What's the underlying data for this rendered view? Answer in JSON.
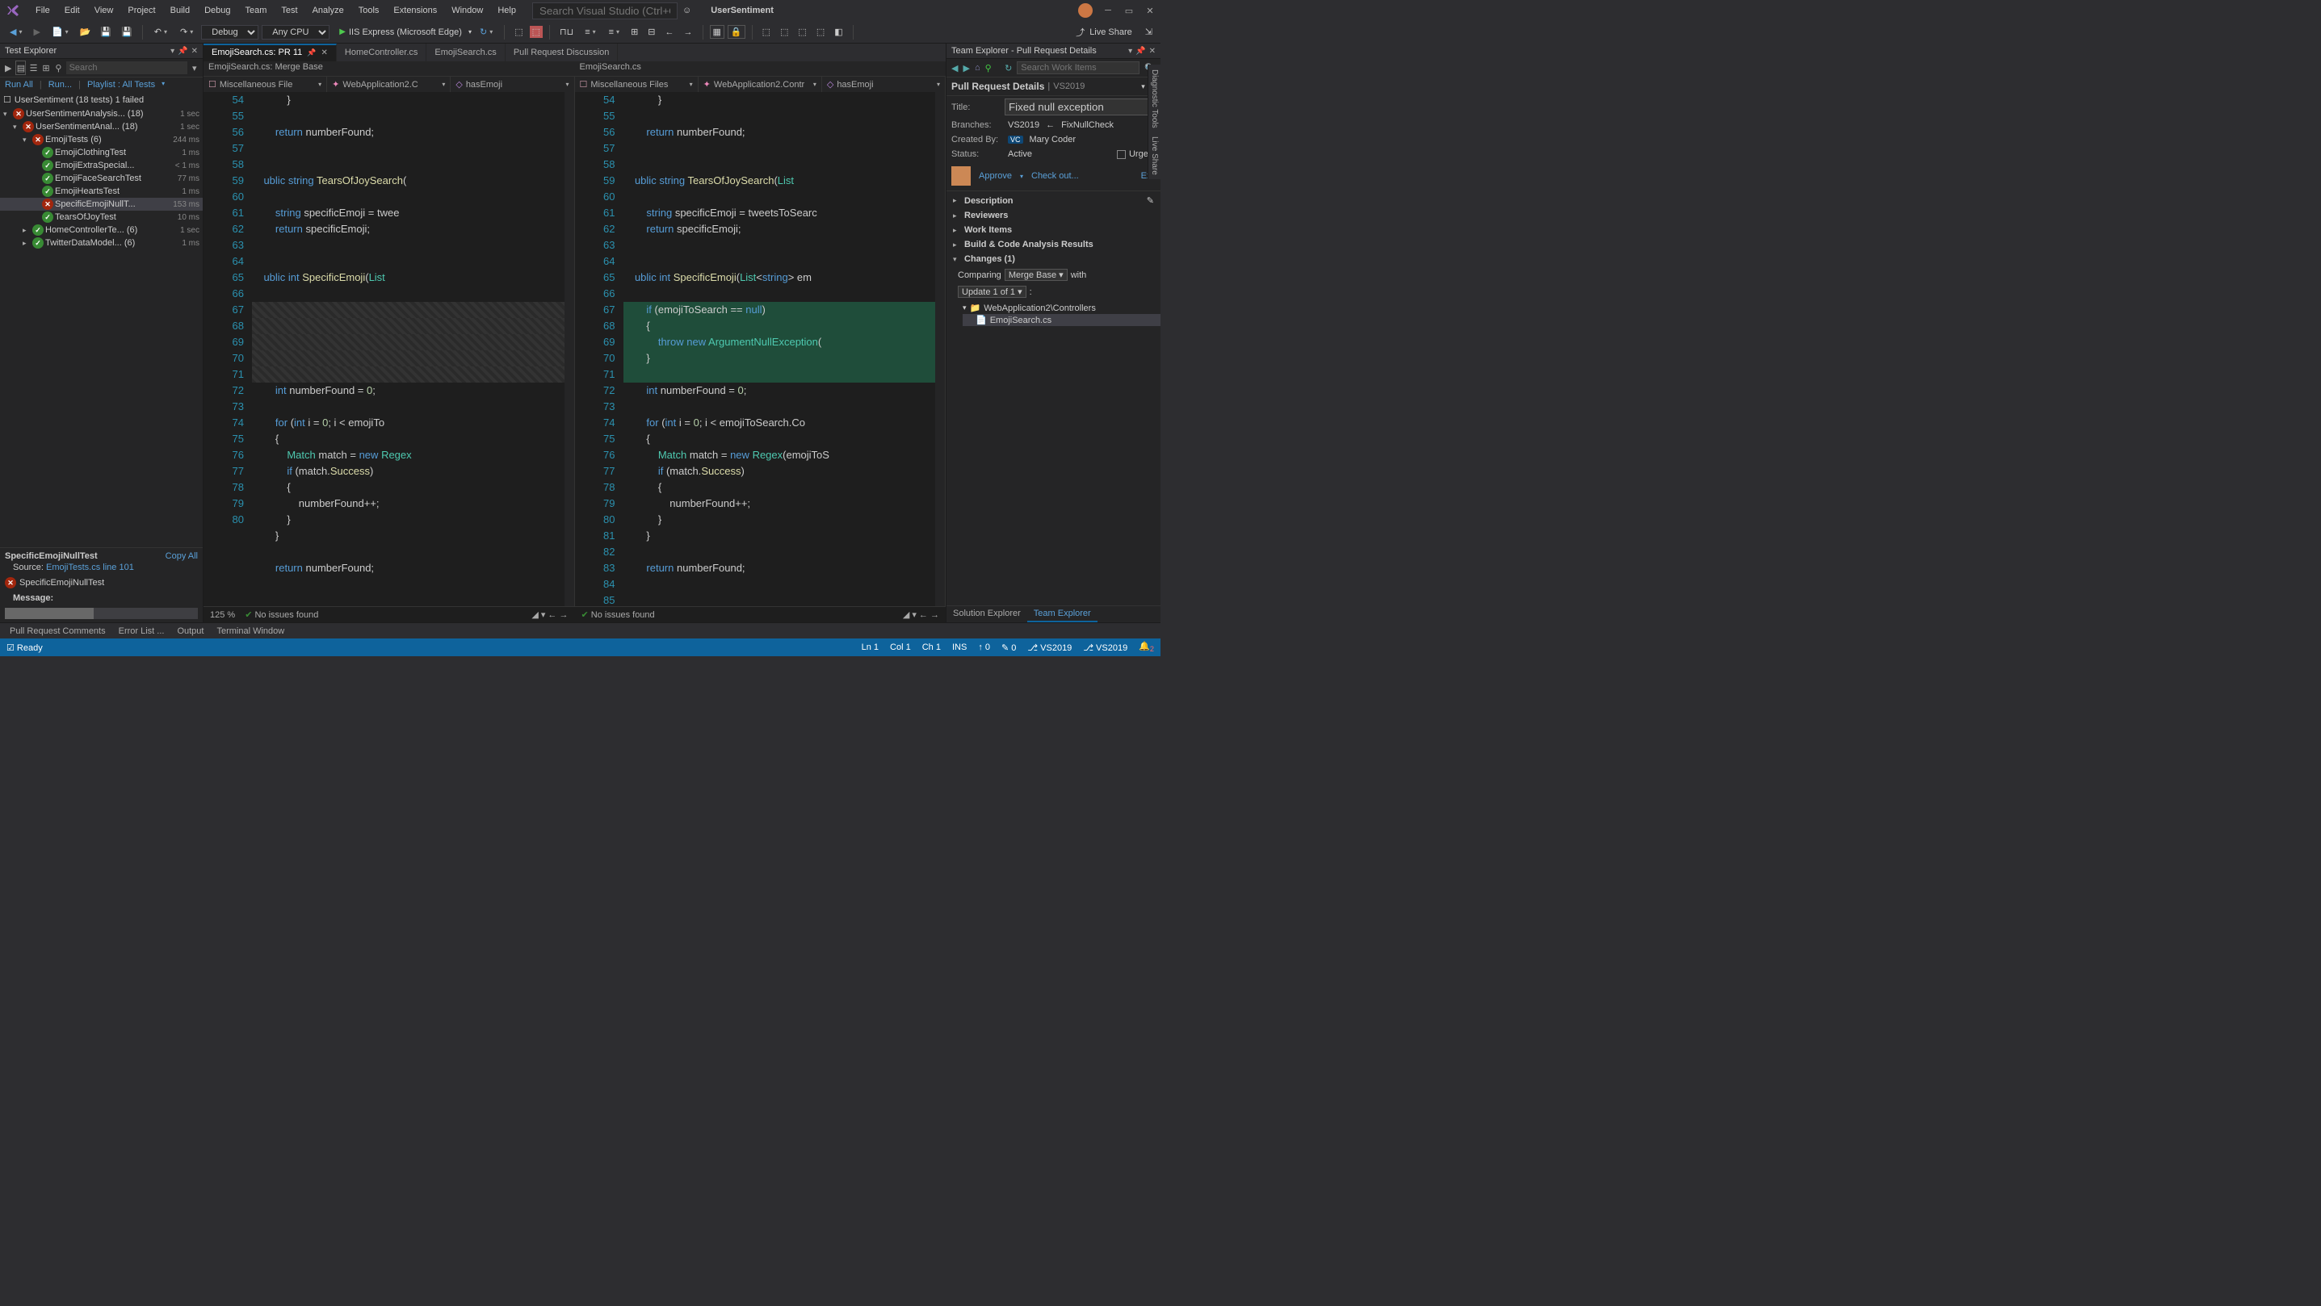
{
  "menu": [
    "File",
    "Edit",
    "View",
    "Project",
    "Build",
    "Debug",
    "Team",
    "Test",
    "Analyze",
    "Tools",
    "Extensions",
    "Window",
    "Help"
  ],
  "menuSearch": "Search Visual Studio (Ctrl+Q)",
  "solutionName": "UserSentiment",
  "toolbar": {
    "config": "Debug",
    "platform": "Any CPU",
    "run": "IIS Express (Microsoft Edge)",
    "liveshare": "Live Share"
  },
  "testExplorer": {
    "title": "Test Explorer",
    "searchPlaceholder": "Search",
    "links": [
      "Run All",
      "Run...",
      "Playlist : All Tests"
    ],
    "summary": "UserSentiment (18 tests) 1 failed",
    "tree": [
      {
        "i": 0,
        "e": "▾",
        "s": "fail",
        "n": "UserSentimentAnalysis... (18)",
        "d": "1 sec"
      },
      {
        "i": 1,
        "e": "▾",
        "s": "fail",
        "n": "UserSentimentAnal... (18)",
        "d": "1 sec"
      },
      {
        "i": 2,
        "e": "▾",
        "s": "fail",
        "n": "EmojiTests (6)",
        "d": "244 ms"
      },
      {
        "i": 3,
        "e": "",
        "s": "pass",
        "n": "EmojiClothingTest",
        "d": "1 ms"
      },
      {
        "i": 3,
        "e": "",
        "s": "pass",
        "n": "EmojiExtraSpecial...",
        "d": "< 1 ms"
      },
      {
        "i": 3,
        "e": "",
        "s": "pass",
        "n": "EmojiFaceSearchTest",
        "d": "77 ms"
      },
      {
        "i": 3,
        "e": "",
        "s": "pass",
        "n": "EmojiHeartsTest",
        "d": "1 ms"
      },
      {
        "i": 3,
        "e": "",
        "s": "fail",
        "n": "SpecificEmojiNullT...",
        "d": "153 ms",
        "sel": true
      },
      {
        "i": 3,
        "e": "",
        "s": "pass",
        "n": "TearsOfJoyTest",
        "d": "10 ms"
      },
      {
        "i": 2,
        "e": "▸",
        "s": "pass",
        "n": "HomeControllerTe... (6)",
        "d": "1 sec"
      },
      {
        "i": 2,
        "e": "▸",
        "s": "pass",
        "n": "TwitterDataModel... (6)",
        "d": "1 ms"
      }
    ],
    "detail": {
      "name": "SpecificEmojiNullTest",
      "copy": "Copy All",
      "sourceLabel": "Source:",
      "source": "EmojiTests.cs line 101",
      "result": "SpecificEmojiNullTest",
      "msgLabel": "Message:"
    }
  },
  "editor": {
    "tabs": [
      {
        "label": "EmojiSearch.cs: PR 11",
        "active": true,
        "pin": true
      },
      {
        "label": "HomeController.cs"
      },
      {
        "label": "EmojiSearch.cs"
      },
      {
        "label": "Pull Request Discussion"
      }
    ],
    "leftTitle": "EmojiSearch.cs: Merge Base",
    "rightTitle": "EmojiSearch.cs",
    "nav": {
      "file": "Miscellaneous File",
      "files": "Miscellaneous Files",
      "class": "WebApplication2.C",
      "classR": "WebApplication2.Contr",
      "member": "hasEmoji"
    },
    "left": {
      "start": 54,
      "lines": [
        "            }",
        "",
        "        return numberFound;",
        "",
        "",
        "    ublic string TearsOfJoySearch(",
        "",
        "        string specificEmoji = twee",
        "        return specificEmoji;",
        "",
        "",
        "    ublic int SpecificEmoji(List<s",
        "",
        "",
        "",
        "",
        "",
        "",
        "        int numberFound = 0;",
        "",
        "        for (int i = 0; i < emojiTo",
        "        {",
        "            Match match = new Regex",
        "            if (match.Success)",
        "            {",
        "                numberFound++;",
        "            }",
        "        }",
        "",
        "        return numberFound;",
        ""
      ],
      "diffRows": [
        13,
        14,
        15,
        16,
        17
      ],
      "nums": [
        54,
        55,
        56,
        57,
        58,
        59,
        60,
        61,
        62,
        63,
        64,
        65,
        66,
        67,
        "",
        "",
        "",
        "",
        "",
        68,
        69,
        70,
        71,
        72,
        73,
        74,
        75,
        76,
        77,
        78,
        79,
        80
      ]
    },
    "right": {
      "start": 54,
      "lines": [
        "            }",
        "",
        "        return numberFound;",
        "",
        "",
        "    ublic string TearsOfJoySearch(List<stri",
        "",
        "        string specificEmoji = tweetsToSearc",
        "        return specificEmoji;",
        "",
        "",
        "    ublic int SpecificEmoji(List<string> em",
        "",
        "        if (emojiToSearch == null)",
        "        {",
        "            throw new ArgumentNullException(",
        "        }",
        "",
        "        int numberFound = 0;",
        "",
        "        for (int i = 0; i < emojiToSearch.Co",
        "        {",
        "            Match match = new Regex(emojiToS",
        "            if (match.Success)",
        "            {",
        "                numberFound++;",
        "            }",
        "        }",
        "",
        "        return numberFound;",
        ""
      ],
      "diffRows": [
        13,
        14,
        15,
        16,
        17
      ],
      "nums": [
        54,
        55,
        56,
        57,
        58,
        59,
        60,
        61,
        62,
        63,
        64,
        65,
        66,
        67,
        68,
        69,
        70,
        71,
        72,
        73,
        74,
        75,
        76,
        77,
        78,
        79,
        80,
        81,
        82,
        83,
        84,
        85
      ]
    },
    "zoom": "125 %",
    "issues": "No issues found"
  },
  "team": {
    "title": "Team Explorer - Pull Request Details",
    "header": "Pull Request Details",
    "sub": "VS2019",
    "searchPlaceholder": "Search Work Items",
    "title_lbl": "Title:",
    "title_val": "Fixed null exception",
    "branches_lbl": "Branches:",
    "branch_tgt": "VS2019",
    "branch_src": "FixNullCheck",
    "created_lbl": "Created By:",
    "created_by": "Mary Coder",
    "created_badge": "VC",
    "status_lbl": "Status:",
    "status_val": "Active",
    "urgent": "Urgent",
    "approve": "Approve",
    "checkout": "Check out...",
    "exit": "Exit",
    "sections": [
      "Description",
      "Reviewers",
      "Work Items",
      "Build & Code Analysis Results"
    ],
    "changes": "Changes (1)",
    "compare": "Comparing",
    "compare_dd": "Merge Base",
    "with": "with",
    "update": "Update 1 of 1",
    "folder": "WebApplication2\\Controllers",
    "file": "EmojiSearch.cs",
    "bottomTabs": [
      "Solution Explorer",
      "Team Explorer"
    ]
  },
  "sideTabs": [
    "Diagnostic Tools",
    "Live Share"
  ],
  "bottomTabs": [
    "Pull Request Comments",
    "Error List ...",
    "Output",
    "Terminal Window"
  ],
  "statusbar": {
    "ready": "Ready",
    "ln": "Ln 1",
    "col": "Col 1",
    "ch": "Ch 1",
    "ins": "INS",
    "up": "0",
    "pen": "0",
    "branch1": "VS2019",
    "branch2": "VS2019",
    "notif": "2"
  }
}
